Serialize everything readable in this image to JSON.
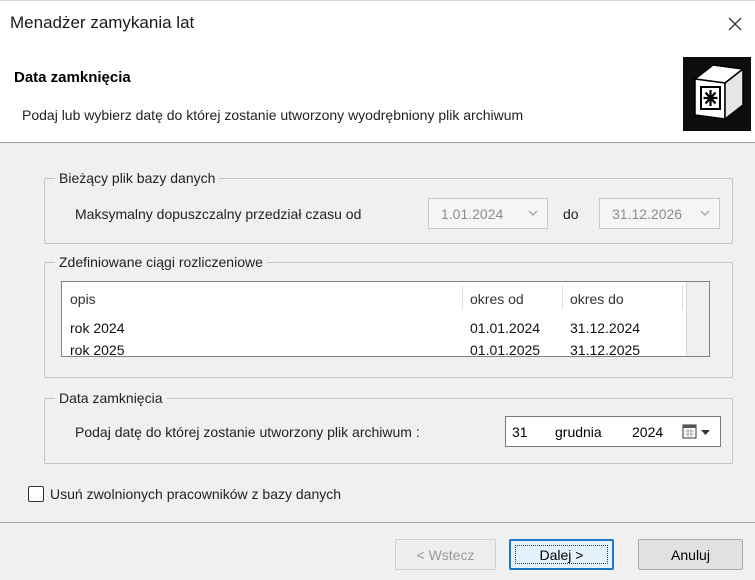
{
  "window": {
    "title": "Menadżer zamykania lat",
    "close_icon": "close-icon"
  },
  "header": {
    "title": "Data zamknięcia",
    "description": "Podaj lub wybierz datę do której zostanie utworzony wyodrębniony plik archiwum",
    "icon": "archive-lock-icon"
  },
  "current_db": {
    "legend": "Bieżący plik bazy danych",
    "label": "Maksymalny dopuszczalny  przedział czasu od",
    "from_value": "1.01.2024",
    "to_label": "do",
    "to_value": "31.12.2026"
  },
  "periods": {
    "legend": "Zdefiniowane ciągi rozliczeniowe",
    "columns": [
      "opis",
      "okres od",
      "okres do"
    ],
    "rows": [
      [
        "rok 2024",
        "01.01.2024",
        "31.12.2024"
      ],
      [
        "rok 2025",
        "01.01.2025",
        "31.12.2025"
      ]
    ]
  },
  "closing_date": {
    "legend": "Data zamknięcia",
    "label": "Podaj datę do której zostanie utworzony plik archiwum :",
    "day": "31",
    "month": "grudnia",
    "year": "2024"
  },
  "options": {
    "remove_fired_label": "Usuń zwolnionych pracowników z bazy danych",
    "remove_fired_checked": false
  },
  "buttons": {
    "back": "< Wstecz",
    "next": "Dalej >",
    "cancel": "Anuluj"
  },
  "colors": {
    "accent": "#1975c6",
    "dialog_bg": "#f0f0f0",
    "disabled_text": "#8c8c8c"
  }
}
